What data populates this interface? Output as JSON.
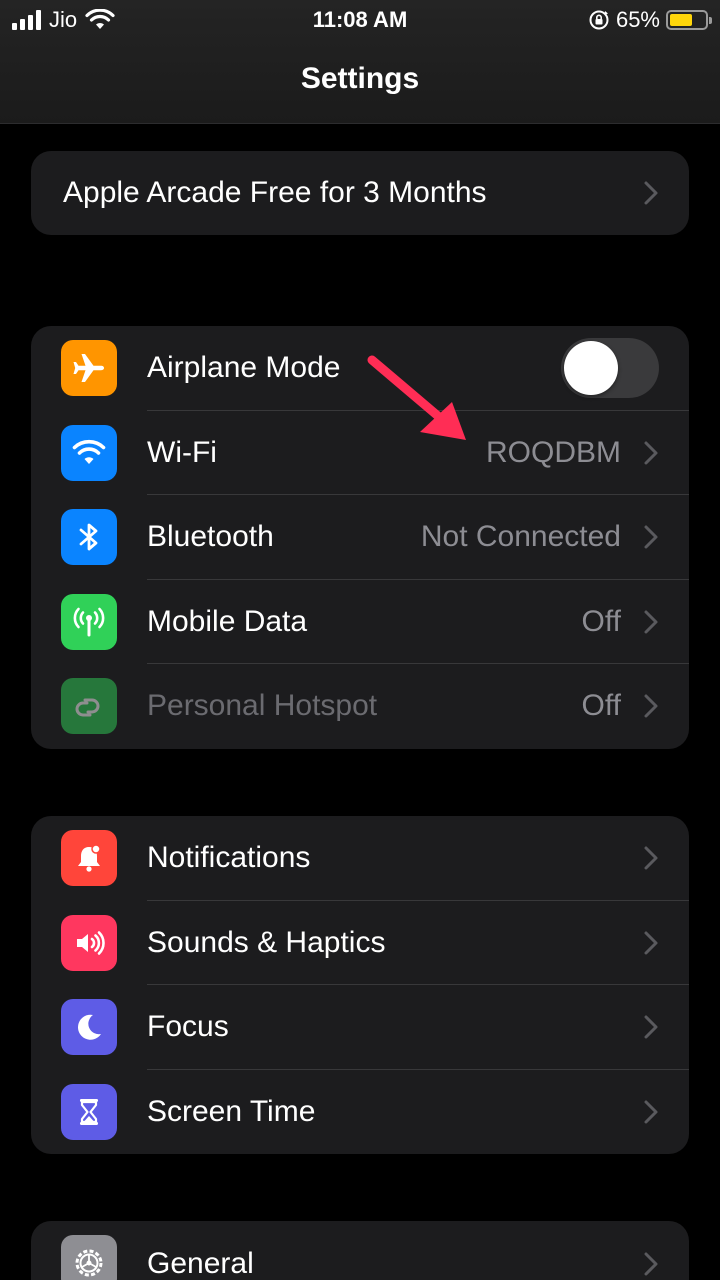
{
  "status_bar": {
    "carrier": "Jio",
    "time": "11:08 AM",
    "battery_percent": "65%",
    "battery_level": 0.65,
    "battery_color": "#ffd60a"
  },
  "nav": {
    "title": "Settings"
  },
  "promo": {
    "label": "Apple Arcade Free for 3 Months"
  },
  "connectivity": [
    {
      "label": "Airplane Mode",
      "icon": "airplane-icon",
      "color": "#ff9500",
      "toggle": false
    },
    {
      "label": "Wi-Fi",
      "value": "ROQDBM",
      "icon": "wifi-icon",
      "color": "#0a84ff"
    },
    {
      "label": "Bluetooth",
      "value": "Not Connected",
      "icon": "bluetooth-icon",
      "color": "#0a84ff"
    },
    {
      "label": "Mobile Data",
      "value": "Off",
      "icon": "antenna-icon",
      "color": "#30d158"
    },
    {
      "label": "Personal Hotspot",
      "value": "Off",
      "icon": "hotspot-icon",
      "color": "#30d158",
      "disabled": true
    }
  ],
  "notifications_group": [
    {
      "label": "Notifications",
      "icon": "bell-icon",
      "color": "#ff453a"
    },
    {
      "label": "Sounds & Haptics",
      "icon": "speaker-icon",
      "color": "#ff375f"
    },
    {
      "label": "Focus",
      "icon": "moon-icon",
      "color": "#5e5ce6"
    },
    {
      "label": "Screen Time",
      "icon": "hourglass-icon",
      "color": "#5e5ce6"
    }
  ],
  "general_group": [
    {
      "label": "General",
      "icon": "gear-icon",
      "color": "#8e8e93"
    }
  ],
  "annotation": {
    "arrow_color": "#ff2d55"
  }
}
